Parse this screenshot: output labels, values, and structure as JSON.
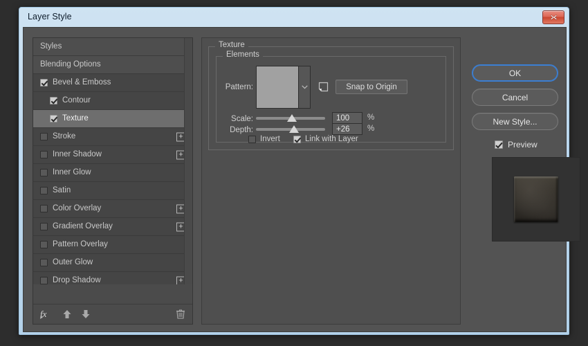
{
  "window": {
    "title": "Layer Style",
    "close_icon": "close-icon"
  },
  "styles_panel": {
    "items": [
      {
        "label": "Styles",
        "type": "header",
        "checkbox": "none",
        "plus": false,
        "selected": false
      },
      {
        "label": "Blending Options",
        "type": "header",
        "checkbox": "none",
        "plus": false,
        "selected": false
      },
      {
        "label": "Bevel & Emboss",
        "type": "parent",
        "checkbox": "checked",
        "plus": false,
        "selected": false
      },
      {
        "label": "Contour",
        "type": "child",
        "checkbox": "checked",
        "plus": false,
        "selected": false
      },
      {
        "label": "Texture",
        "type": "child",
        "checkbox": "checked",
        "plus": false,
        "selected": true
      },
      {
        "label": "Stroke",
        "type": "parent",
        "checkbox": "unchecked",
        "plus": true,
        "selected": false
      },
      {
        "label": "Inner Shadow",
        "type": "parent",
        "checkbox": "unchecked",
        "plus": true,
        "selected": false
      },
      {
        "label": "Inner Glow",
        "type": "parent",
        "checkbox": "unchecked",
        "plus": false,
        "selected": false
      },
      {
        "label": "Satin",
        "type": "parent",
        "checkbox": "unchecked",
        "plus": false,
        "selected": false
      },
      {
        "label": "Color Overlay",
        "type": "parent",
        "checkbox": "unchecked",
        "plus": true,
        "selected": false
      },
      {
        "label": "Gradient Overlay",
        "type": "parent",
        "checkbox": "unchecked",
        "plus": true,
        "selected": false
      },
      {
        "label": "Pattern Overlay",
        "type": "parent",
        "checkbox": "unchecked",
        "plus": false,
        "selected": false
      },
      {
        "label": "Outer Glow",
        "type": "parent",
        "checkbox": "unchecked",
        "plus": false,
        "selected": false
      },
      {
        "label": "Drop Shadow",
        "type": "parent",
        "checkbox": "unchecked",
        "plus": true,
        "selected": false
      }
    ],
    "toolbar": {
      "fx_label": "fx",
      "move_up_icon": "arrow-up-icon",
      "move_down_icon": "arrow-down-icon",
      "delete_icon": "trash-icon"
    }
  },
  "texture_panel": {
    "group_title": "Texture",
    "subgroup_title": "Elements",
    "pattern_label": "Pattern:",
    "pattern_swatch_icon": "pattern-thumbnail",
    "pattern_dropdown_icon": "chevron-down-icon",
    "new_preset_icon": "new-preset-icon",
    "snap_to_origin_label": "Snap to Origin",
    "scale_label": "Scale:",
    "scale_value": "100",
    "scale_unit": "%",
    "scale_slider_percent": 52,
    "depth_label": "Depth:",
    "depth_value": "+26",
    "depth_unit": "%",
    "depth_slider_percent": 55,
    "invert_label": "Invert",
    "invert_checked": false,
    "link_with_layer_label": "Link with Layer",
    "link_with_layer_checked": true
  },
  "right_panel": {
    "ok_label": "OK",
    "cancel_label": "Cancel",
    "new_style_label": "New Style...",
    "preview_label": "Preview",
    "preview_checked": true
  },
  "colors": {
    "accent_focus": "#3b7fd4",
    "dialog_bg": "#535353",
    "panel_bg": "#4f4f4f",
    "selected_row": "#6e6e6e",
    "close_button": "#c9452f"
  }
}
